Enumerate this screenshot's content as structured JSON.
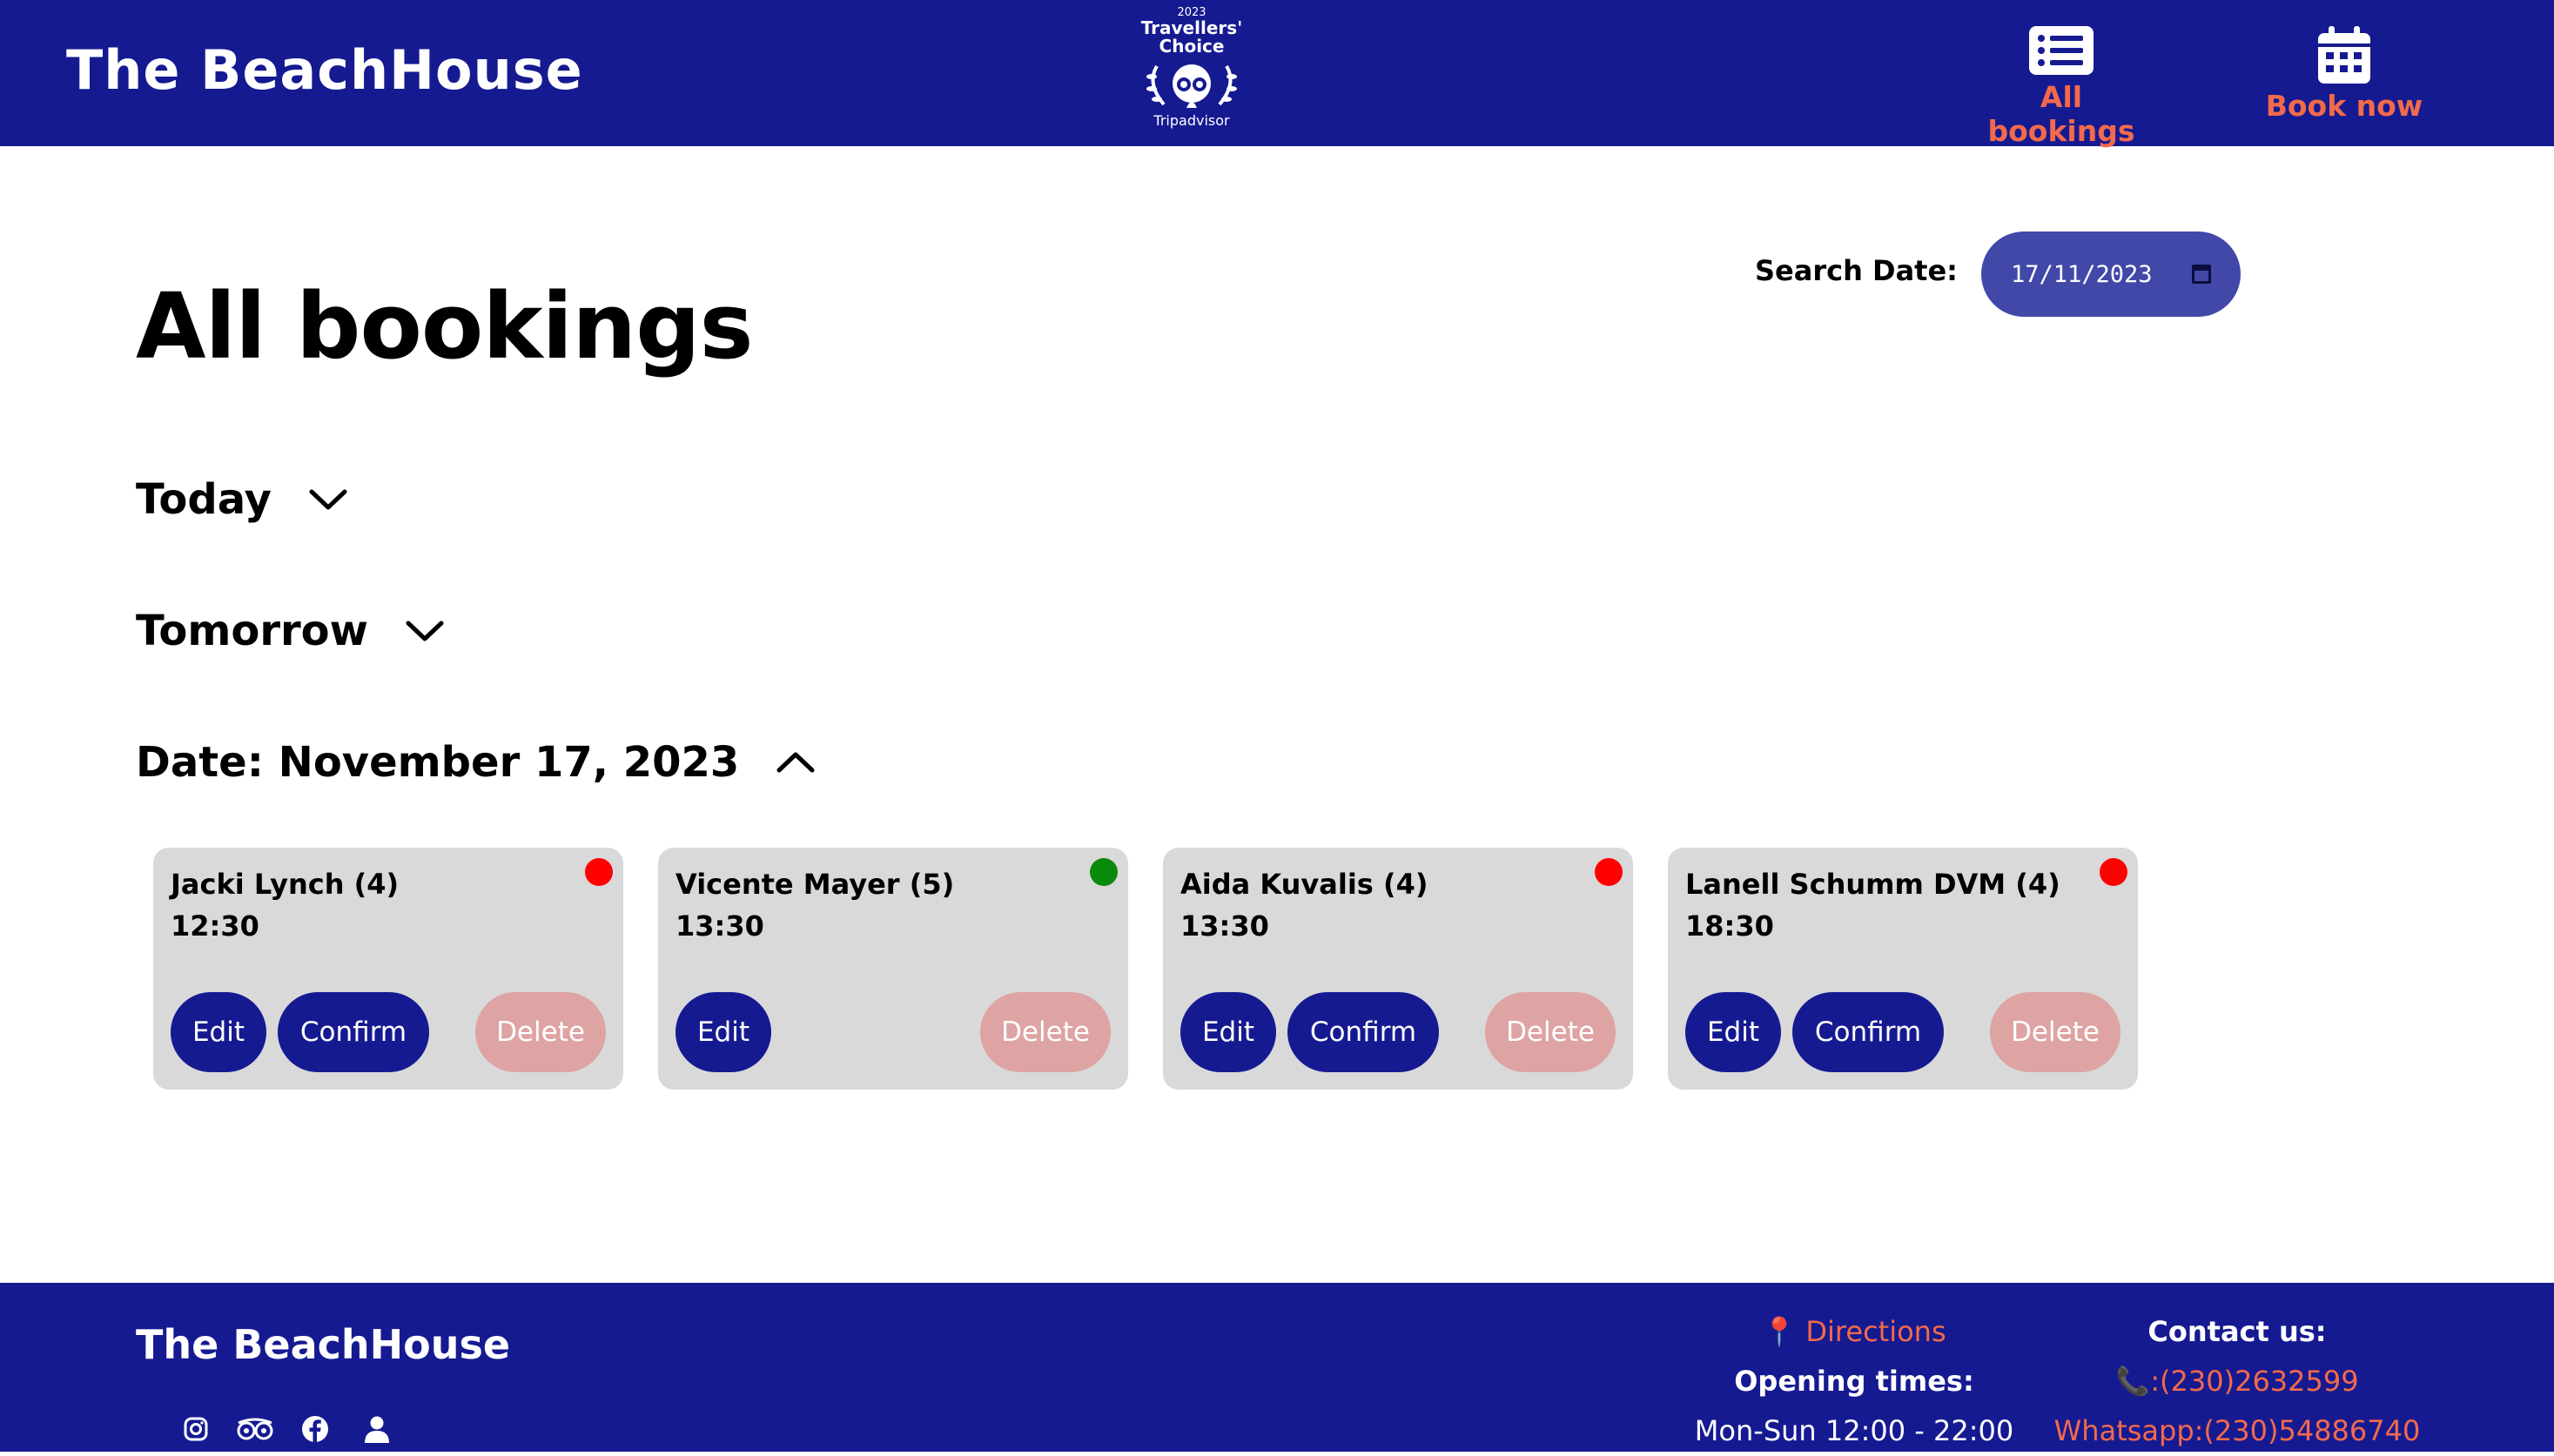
{
  "header": {
    "brand": "The BeachHouse",
    "badge": {
      "year": "2023",
      "line1": "Travellers'",
      "line2": "Choice",
      "line3": "Tripadvisor"
    },
    "nav": [
      {
        "label": "All bookings",
        "icon": "list-icon"
      },
      {
        "label": "Book now",
        "icon": "calendar-icon"
      }
    ]
  },
  "main": {
    "title": "All bookings",
    "search": {
      "label": "Search Date:",
      "value": "17/11/2023"
    },
    "sections": {
      "today": "Today",
      "tomorrow": "Tomorrow",
      "date": "Date: November 17, 2023"
    },
    "bookings": [
      {
        "name": "Jacki Lynch (4)",
        "time": "12:30",
        "status": "unconfirmed",
        "status_color": "#ff0000",
        "edit": "Edit",
        "confirm": "Confirm",
        "delete": "Delete"
      },
      {
        "name": "Vicente Mayer (5)",
        "time": "13:30",
        "status": "confirmed",
        "status_color": "#0a8a0a",
        "edit": "Edit",
        "delete": "Delete"
      },
      {
        "name": "Aida Kuvalis (4)",
        "time": "13:30",
        "status": "unconfirmed",
        "status_color": "#ff0000",
        "edit": "Edit",
        "confirm": "Confirm",
        "delete": "Delete"
      },
      {
        "name": "Lanell Schumm DVM (4)",
        "time": "18:30",
        "status": "unconfirmed",
        "status_color": "#ff0000",
        "edit": "Edit",
        "confirm": "Confirm",
        "delete": "Delete"
      }
    ]
  },
  "footer": {
    "brand": "The BeachHouse",
    "directions": "Directions",
    "opening_label": "Opening times:",
    "opening_hours": "Mon-Sun 12:00 - 22:00",
    "contact_label": "Contact us:",
    "phone": ":(230)2632599",
    "whatsapp": "Whatsapp:(230)54886740",
    "social_icons": [
      "instagram-icon",
      "tripadvisor-icon",
      "facebook-icon",
      "user-icon"
    ]
  },
  "colors": {
    "primary": "#161a91",
    "accent": "#f26a4b",
    "card": "#d9d9d9",
    "delete": "#dea3a3",
    "search_input": "#4148a8"
  }
}
